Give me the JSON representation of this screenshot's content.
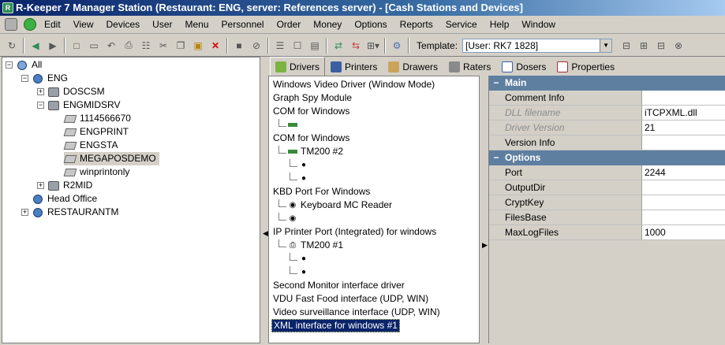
{
  "window": {
    "title": "R-Keeper 7 Manager Station (Restaurant: ENG, server: References server) - [Cash Stations and Devices]"
  },
  "menu": [
    "Edit",
    "View",
    "Devices",
    "User",
    "Menu",
    "Personnel",
    "Order",
    "Money",
    "Options",
    "Reports",
    "Service",
    "Help",
    "Window"
  ],
  "toolbar": {
    "template_label": "Template:",
    "template_value": "[User: RK7 1828]"
  },
  "tree": {
    "root": "All",
    "eng": "ENG",
    "doscsm": "DOSCSM",
    "engmidsrv": "ENGMIDSRV",
    "st1": "1114566670",
    "st2": "ENGPRINT",
    "st3": "ENGSTA",
    "st4": "MEGAPOSDEMO",
    "st5": "winprintonly",
    "r2mid": "R2MID",
    "head_office": "Head Office",
    "restaurantm": "RESTAURANTM"
  },
  "tabs": [
    "Drivers",
    "Printers",
    "Drawers",
    "Raters",
    "Dosers",
    "Properties"
  ],
  "drivers": {
    "d1": "Windows Video Driver (Window Mode)",
    "d2": "Graph Spy Module",
    "d3": "COM for Windows",
    "d4": "COM for Windows",
    "d4_child": "TM200 #2",
    "d5": "KBD Port For Windows",
    "d5_child": "Keyboard MC Reader",
    "d6": "IP Printer Port (Integrated) for windows",
    "d6_child": "TM200 #1",
    "d7": "Second Monitor interface driver",
    "d8": "VDU Fast Food interface (UDP, WIN)",
    "d9": "Video surveillance interface (UDP, WIN)",
    "d10": "XML interface for windows #1"
  },
  "properties": {
    "main_title": "Main",
    "comment_info": {
      "name": "Comment Info",
      "value": ""
    },
    "dll_filename": {
      "name": "DLL filename",
      "value": "iTCPXML.dll"
    },
    "driver_version": {
      "name": "Driver Version",
      "value": "21"
    },
    "version_info": {
      "name": "Version Info",
      "value": ""
    },
    "options_title": "Options",
    "port": {
      "name": "Port",
      "value": "2244"
    },
    "output_dir": {
      "name": "OutputDir",
      "value": ""
    },
    "crypt_key": {
      "name": "CryptKey",
      "value": ""
    },
    "files_base": {
      "name": "FilesBase",
      "value": ""
    },
    "max_log_files": {
      "name": "MaxLogFiles",
      "value": "1000"
    }
  },
  "colors": {
    "title_start": "#0a246a",
    "section_header": "#5f7fa0",
    "selection": "#0a246a"
  }
}
